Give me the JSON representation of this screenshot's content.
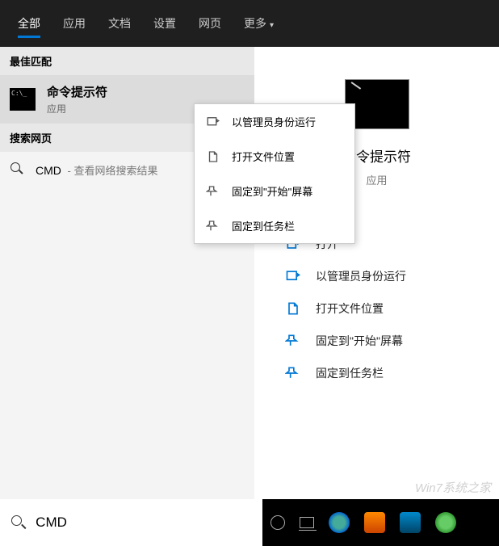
{
  "tabs": {
    "all": "全部",
    "apps": "应用",
    "docs": "文档",
    "settings": "设置",
    "web": "网页",
    "more": "更多"
  },
  "sections": {
    "best_match": "最佳匹配",
    "search_web": "搜索网页"
  },
  "best_result": {
    "title": "命令提示符",
    "subtitle": "应用"
  },
  "web_result": {
    "query": "CMD",
    "suffix": " - 查看网络搜索结果"
  },
  "context_menu": {
    "run_admin": "以管理员身份运行",
    "open_location": "打开文件位置",
    "pin_start": "固定到\"开始\"屏幕",
    "pin_taskbar": "固定到任务栏"
  },
  "detail": {
    "title": "命令提示符",
    "subtitle": "应用",
    "open": "打开",
    "run_admin": "以管理员身份运行",
    "open_location": "打开文件位置",
    "pin_start": "固定到\"开始\"屏幕",
    "pin_taskbar": "固定到任务栏"
  },
  "search": {
    "value": "CMD"
  },
  "watermark": "Win7系统之家"
}
